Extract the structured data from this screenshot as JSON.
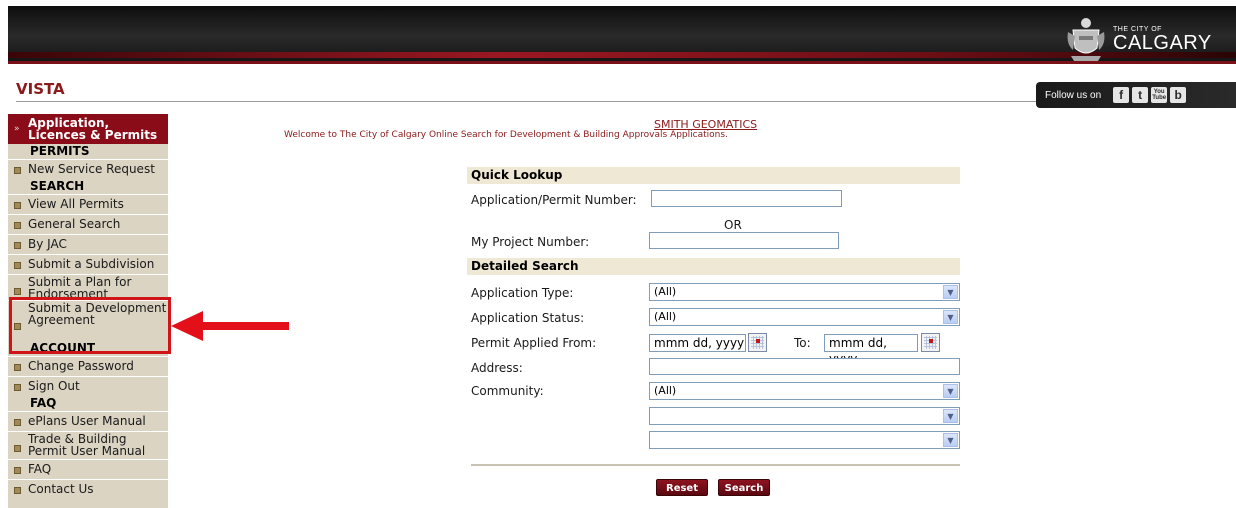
{
  "header": {
    "logo_small": "THE CITY OF",
    "logo_big": "CALGARY",
    "app_title": "VISTA",
    "follow_label": "Follow us on",
    "social": [
      "f",
      "t",
      "You Tube",
      "b"
    ]
  },
  "sidebar": {
    "active": "Application, Licences & Permits",
    "sections": {
      "permits": "PERMITS",
      "search": "SEARCH",
      "account": "ACCOUNT",
      "faq": "FAQ"
    },
    "items": {
      "new_service_request": "New Service Request",
      "view_all_permits": "View All Permits",
      "general_search": "General Search",
      "by_jac": "By JAC",
      "submit_subdivision": "Submit a Subdivision",
      "submit_plan": "Submit a Plan for Endorsement",
      "submit_development": "Submit a Development Agreement",
      "change_password": "Change Password",
      "sign_out": "Sign Out",
      "eplans_manual": "ePlans User Manual",
      "trade_manual": "Trade & Building Permit User Manual",
      "faq": "FAQ",
      "contact": "Contact Us"
    }
  },
  "main": {
    "company": "SMITH GEOMATICS",
    "welcome": "Welcome to The City of Calgary Online Search for Development & Building Approvals Applications.",
    "quick_lookup": "Quick Lookup",
    "app_permit_label": "Application/Permit Number:",
    "or": "OR",
    "project_label": "My Project Number:",
    "detailed_search": "Detailed Search",
    "app_type_label": "Application Type:",
    "app_type_value": "(All)",
    "app_status_label": "Application Status:",
    "app_status_value": "(All)",
    "applied_from_label": "Permit Applied From:",
    "date_placeholder": "mmm dd, yyyy",
    "to_label": "To:",
    "address_label": "Address:",
    "community_label": "Community:",
    "community_value": "(All)",
    "reset": "Reset",
    "search": "Search"
  },
  "colors": {
    "accent": "#8a0c18",
    "sidebar_bg": "#dbd4c3",
    "section_bg": "#efe8d5",
    "annotation": "#d01418"
  }
}
